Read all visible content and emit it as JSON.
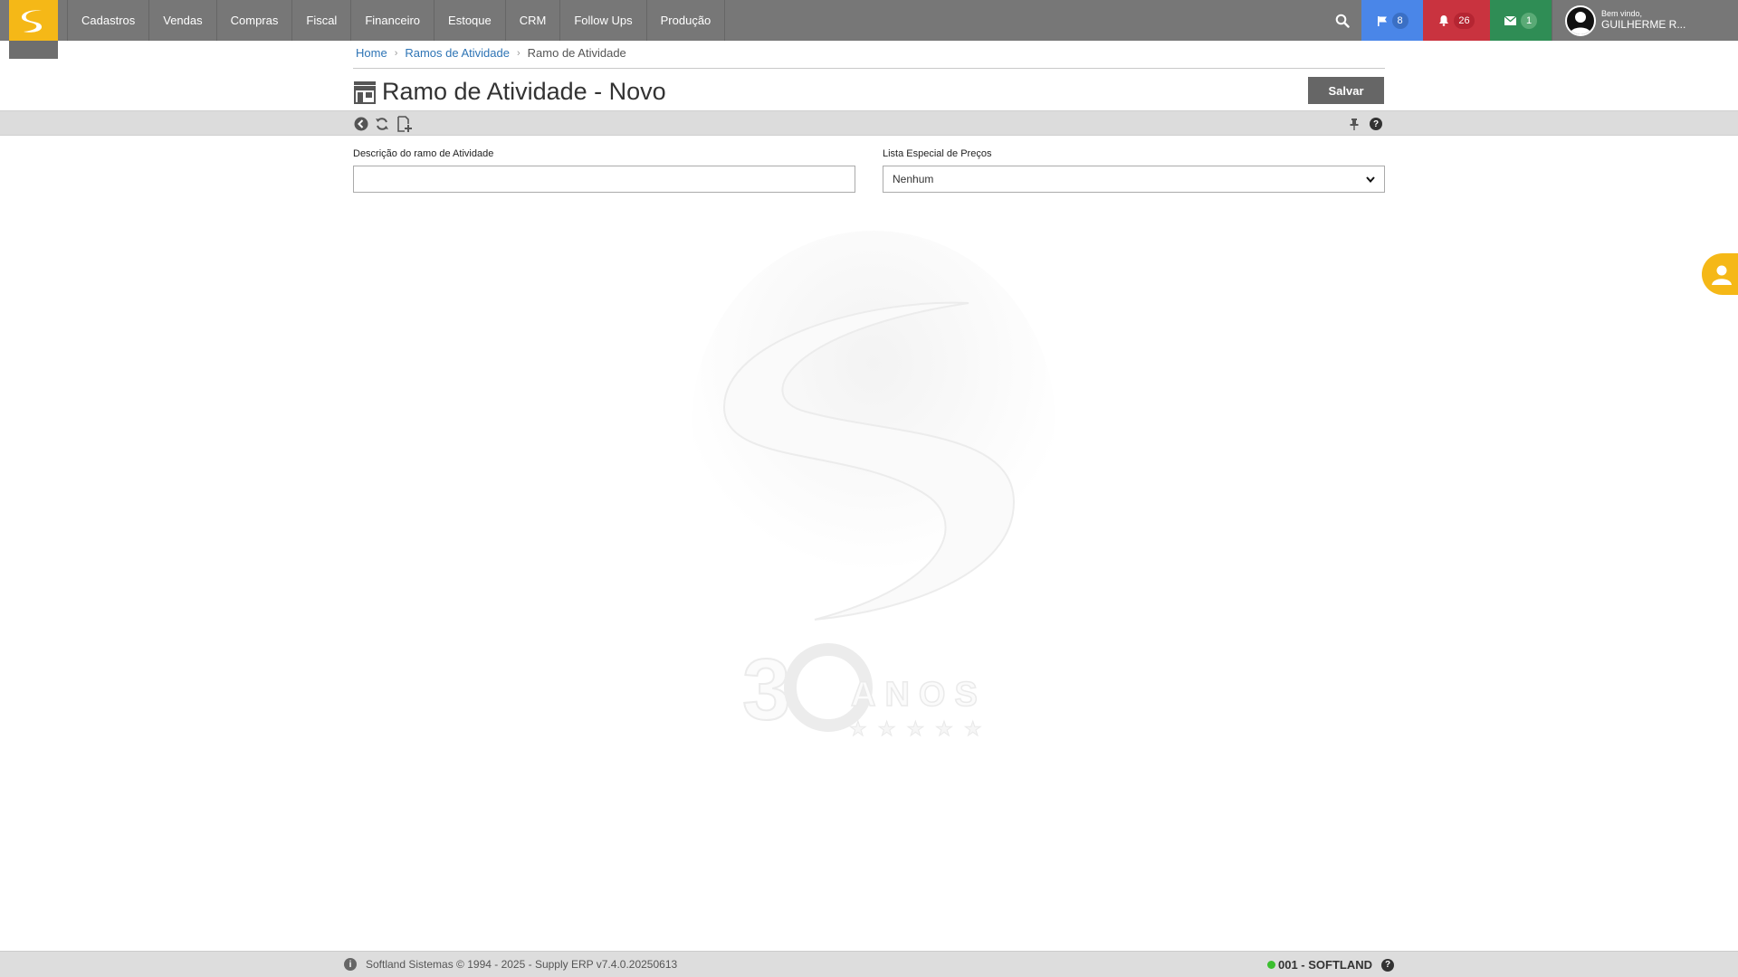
{
  "nav": {
    "items": [
      "Cadastros",
      "Vendas",
      "Compras",
      "Fiscal",
      "Financeiro",
      "Estoque",
      "CRM",
      "Follow Ups",
      "Produção"
    ]
  },
  "notifications": {
    "flags": "8",
    "alerts": "26",
    "messages": "1"
  },
  "user": {
    "greeting": "Bem vindo,",
    "name": "GUILHERME R..."
  },
  "breadcrumb": {
    "home": "Home",
    "parent": "Ramos de Atividade",
    "current": "Ramo de Atividade"
  },
  "page": {
    "title": "Ramo de Atividade - Novo",
    "save_label": "Salvar"
  },
  "form": {
    "descricao_label": "Descrição do ramo de Atividade",
    "descricao_value": "",
    "lista_label": "Lista Especial de Preços",
    "lista_value": "Nenhum"
  },
  "footer": {
    "copyright": "Softland Sistemas © 1994 - 2025 - Supply ERP v7.4.0.20250613",
    "company": "001 - SOFTLAND"
  },
  "colors": {
    "topbar": "#777777",
    "brand_yellow": "#f5b817",
    "flags_blue": "#4a86e8",
    "alerts_red": "#c9333f",
    "messages_green": "#2f8d55",
    "link": "#2e74b5"
  }
}
